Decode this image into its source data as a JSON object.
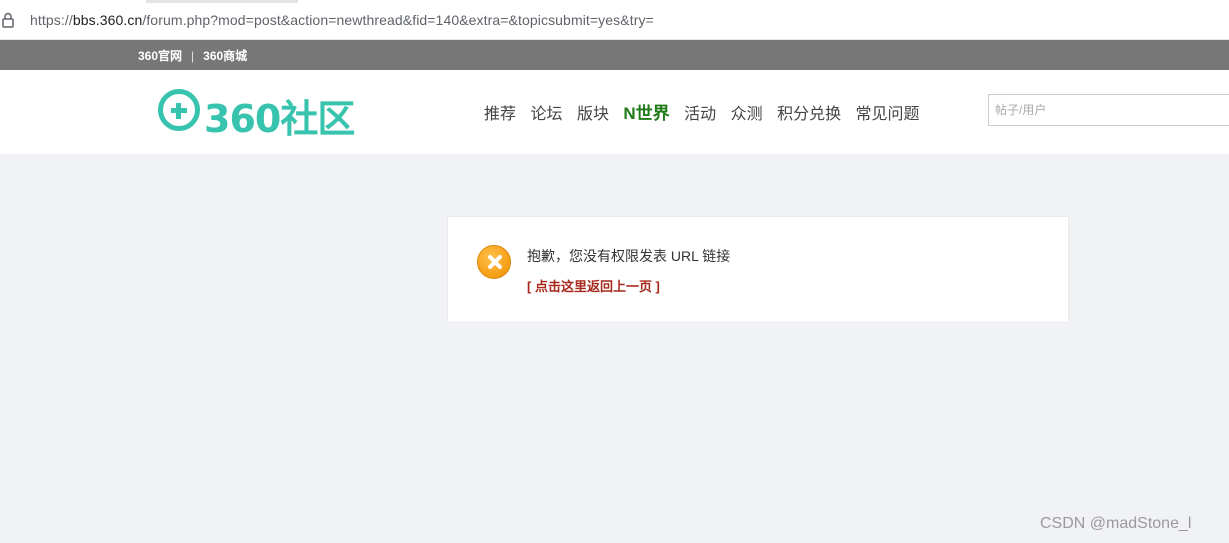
{
  "browser": {
    "url_prefix": "https://",
    "url_host": "bbs.360.cn",
    "url_path": "/forum.php?mod=post&action=newthread&fid=140&extra=&topicsubmit=yes&try="
  },
  "topbar": {
    "links": [
      "360官网",
      "360商城"
    ],
    "separator": "|"
  },
  "header": {
    "logo_text": "360社区",
    "nav": [
      {
        "label": "推荐"
      },
      {
        "label": "论坛"
      },
      {
        "label": "版块"
      },
      {
        "label": "N世界",
        "active": true
      },
      {
        "label": "活动"
      },
      {
        "label": "众测"
      },
      {
        "label": "积分兑换"
      },
      {
        "label": "常见问题"
      }
    ],
    "search_placeholder": "帖子/用户"
  },
  "message": {
    "text": "抱歉，您没有权限发表 URL 链接",
    "back_link": "[ 点击这里返回上一页 ]"
  },
  "watermark": "CSDN @madStone_l",
  "colors": {
    "brand": "#37c3ad",
    "topbar": "#777777",
    "nav_active": "#1f7a17",
    "link": "#a7291d",
    "error_icon": "#f7a21b"
  }
}
